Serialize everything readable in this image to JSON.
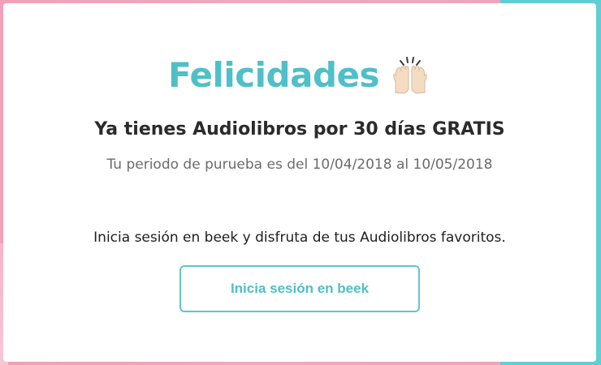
{
  "dialog": {
    "title": "Felicidades",
    "title_icon": "raising-hands-icon",
    "subtitle": "Ya tienes Audiolibros por 30 días GRATIS",
    "trial_period": "Tu periodo de purueba es del 10/04/2018 al 10/05/2018",
    "invite_text": "Inicia sesión en beek y disfruta de tus Audiolibros favoritos.",
    "login_button_label": "Inicia sesión en beek"
  },
  "colors": {
    "accent_teal": "#4fbfc8",
    "background_pink": "#f2a3bb",
    "background_teal": "#5fcfd3"
  }
}
